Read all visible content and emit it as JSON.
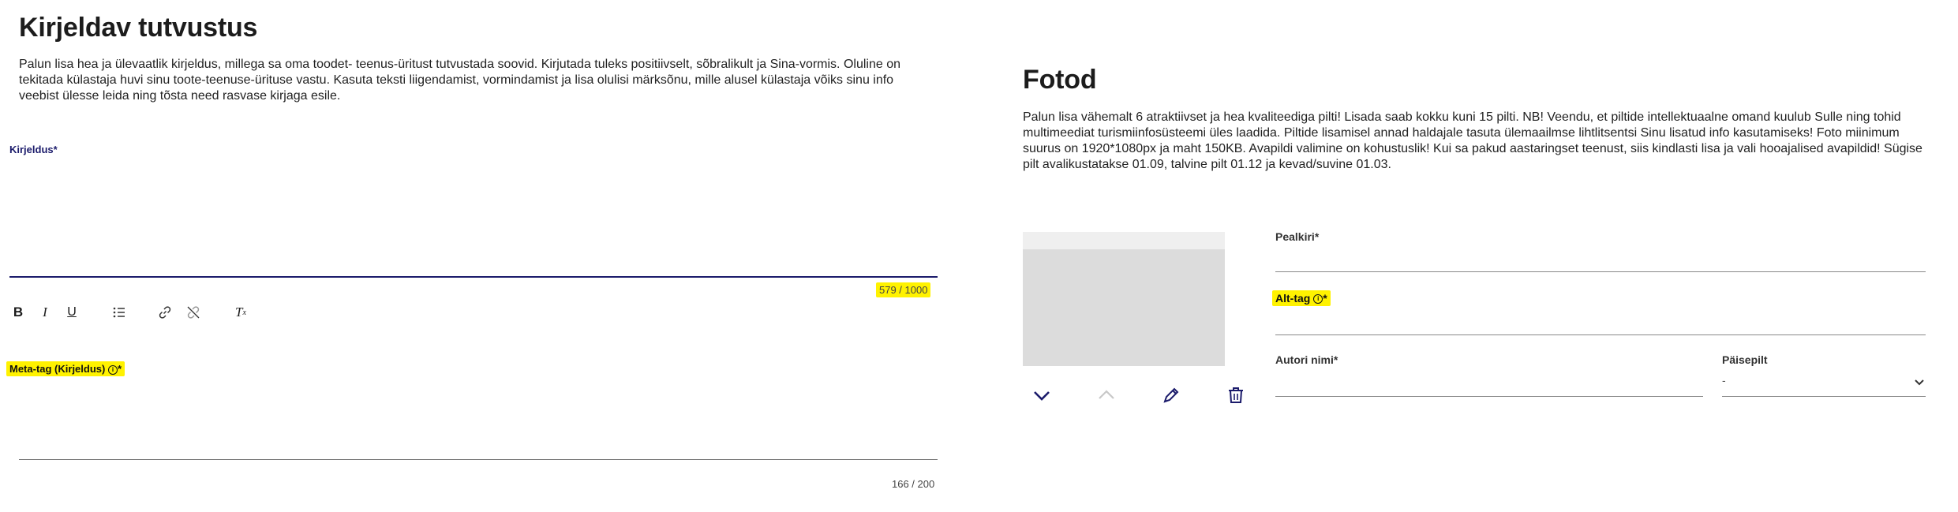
{
  "description": {
    "title": "Kirjeldav tutvustus",
    "intro": "Palun lisa hea ja ülevaatlik kirjeldus, millega sa oma toodet- teenus-üritust tutvustada soovid. Kirjutada tuleks positiivselt, sõbralikult ja Sina-vormis. Oluline on tekitada külastaja huvi sinu toote-teenuse-ürituse vastu. Kasuta teksti liigendamist, vormindamist ja lisa olulisi märksõnu, mille alusel külastaja võiks sinu info veebist ülesse leida ning tõsta need rasvase kirjaga esile.",
    "field_label": "Kirjeldus*",
    "counter": "579 / 1000",
    "meta_label": "Meta-tag (Kirjeldus)",
    "meta_required": "*",
    "meta_counter": "166 / 200"
  },
  "toolbar": {
    "bold": "B",
    "italic": "I",
    "underline": "U",
    "clear_format": "T",
    "clear_sub": "x"
  },
  "photos": {
    "title": "Fotod",
    "intro": "Palun lisa vähemalt 6 atraktiivset ja hea kvaliteediga pilti! Lisada saab kokku kuni 15 pilti. NB! Veendu, et piltide intellektuaalne omand kuulub Sulle ning tohid multimeediat turismiinfosüsteemi üles laadida. Piltide lisamisel annad haldajale tasuta ülemaailmse lihtlitsentsi Sinu lisatud info kasutamiseks! Foto miinimum suurus on 1920*1080px ja maht 150KB. Avapildi valimine on kohustuslik! Kui sa pakud aastaringset teenust, siis kindlasti lisa ja vali hooajalised avapildid! Sügise pilt avalikustatakse 01.09, talvine pilt 01.12 ja kevad/suvine 01.03.",
    "pealkiri_label": "Pealkiri*",
    "alt_label": "Alt-tag",
    "alt_required": "*",
    "author_label": "Autori nimi*",
    "cover_label": "Päisepilt",
    "cover_value": "-"
  },
  "colors": {
    "highlight": "#fff200",
    "accent": "#1b1b6b",
    "placeholder": "#dcdcdc"
  },
  "icons": [
    "bullet-list-icon",
    "link-icon",
    "unlink-icon",
    "chevron-down-icon",
    "chevron-up-icon",
    "pencil-icon",
    "trash-icon",
    "info-icon"
  ]
}
